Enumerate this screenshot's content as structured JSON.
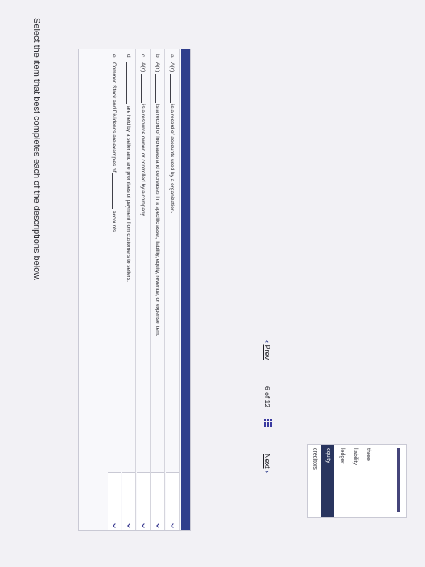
{
  "instruction": "Select the item that best completes each of the descriptions below.",
  "rows": [
    {
      "letter": "a.",
      "lead": "A(n)",
      "text": "is a record of accounts used by a organization."
    },
    {
      "letter": "b.",
      "lead": "A(n)",
      "text": "is a record of increases and decreases in a specific asset, liability, equity, revenue, or expense item."
    },
    {
      "letter": "c.",
      "lead": "A(n)",
      "text": "is a resource owned or controlled by a company."
    },
    {
      "letter": "d.",
      "lead": "",
      "text": "are held by a seller and are promises of payment from customers to sellers."
    },
    {
      "letter": "e.",
      "lead": "Common Stock and Dividends are examples of",
      "text": "accounts."
    }
  ],
  "choices": [
    "creditors",
    "equity",
    "ledger",
    "liability",
    "three"
  ],
  "selected_choice": "equity",
  "pager": {
    "prev_label": "Prev",
    "counter": "6 of 12",
    "next_label": "Next"
  },
  "colors": {
    "header": "#2f3e8c",
    "highlight": "#29355f"
  }
}
